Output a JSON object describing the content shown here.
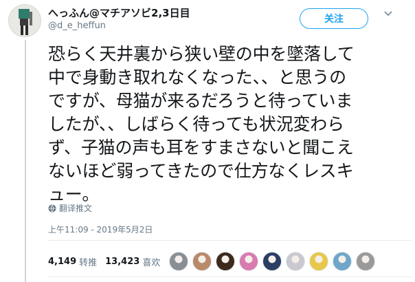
{
  "user": {
    "display_name": "へっふん@マチアソビ2,3日目",
    "handle": "@d_e_heffun"
  },
  "follow_label": "关注",
  "tweet": {
    "lines": [
      "恐らく天井裏から狭い壁の中を墜落して",
      "中で身動き取れなくなった、、と思うの",
      "ですが、母猫が来るだろうと待っていま",
      "したが、、しばらく待っても状況変わら",
      "ず、子猫の声も耳をすまさないと聞こえ",
      "ないほど弱ってきたので仕方なくレスキ",
      "ュー。"
    ]
  },
  "translate_label": "翻译推文",
  "timestamp": "上午11:09 - 2019年5月2日",
  "stats": {
    "retweets": "4,149",
    "retweets_label": "转推",
    "likes": "13,423",
    "likes_label": "喜欢"
  },
  "likers": [
    {
      "icon": "liker-avatar",
      "color": "#8a8f96"
    },
    {
      "icon": "liker-avatar",
      "color": "#b98a6a"
    },
    {
      "icon": "liker-avatar",
      "color": "#3c2a1e"
    },
    {
      "icon": "liker-avatar",
      "color": "#d97ab0"
    },
    {
      "icon": "liker-avatar",
      "color": "#2c3e63"
    },
    {
      "icon": "liker-avatar",
      "color": "#c9c9cf"
    },
    {
      "icon": "liker-avatar",
      "color": "#e8c84a"
    },
    {
      "icon": "liker-avatar",
      "color": "#6fa6c9"
    },
    {
      "icon": "liker-avatar",
      "color": "#9a9a9a"
    }
  ],
  "colors": {
    "accent": "#1da1f2",
    "secondary_text": "#657786",
    "primary_text": "#14171a"
  }
}
